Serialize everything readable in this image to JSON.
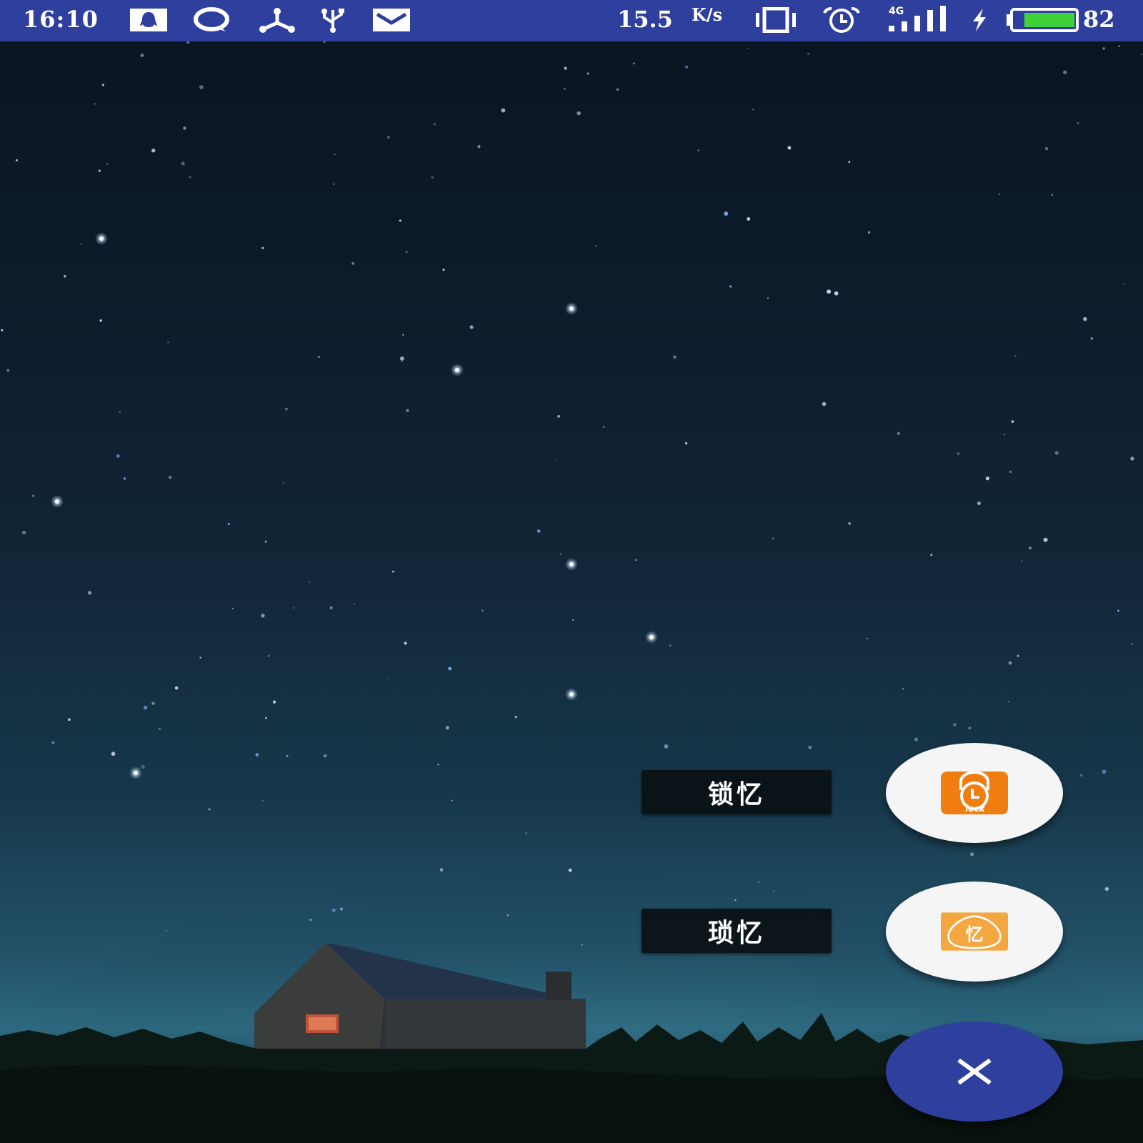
{
  "status_bar": {
    "time": "16:10",
    "network_speed": "15.5",
    "network_speed_unit": "K/s",
    "signal_label": "4G",
    "battery_level": "82",
    "color": "#2e3f9d",
    "icons": [
      "qq-icon",
      "chat-bubble-icon",
      "share-icon",
      "usb-icon",
      "mail-icon",
      "vibrate-icon",
      "alarm-icon",
      "signal-4g-icon",
      "charging-icon",
      "battery-icon"
    ]
  },
  "fab_menu": {
    "items": [
      {
        "label": "锁忆",
        "icon": "lock-app-icon",
        "icon_text": "lock"
      },
      {
        "label": "琐忆",
        "icon": "yi-app-icon",
        "icon_text": "忆"
      }
    ],
    "close_icon": "close-icon",
    "main_color": "#2e3f9d",
    "icon_color": "#f07d10"
  }
}
